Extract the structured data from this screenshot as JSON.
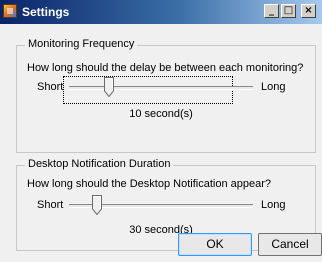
{
  "window": {
    "title": "Settings",
    "minimize_glyph": "_",
    "maximize_glyph": "□",
    "close_glyph": "×"
  },
  "monitoring": {
    "group_title": "Monitoring Frequency",
    "question": "How long should the delay be between each monitoring?",
    "min_label": "Short",
    "max_label": "Long",
    "value_text": "10 second(s)",
    "slider_level": 0.22
  },
  "notification": {
    "group_title": "Desktop Notification Duration",
    "question": "How long should the Desktop Notification appear?",
    "min_label": "Short",
    "max_label": "Long",
    "value_text": "30 second(s)",
    "slider_level": 0.15
  },
  "buttons": {
    "ok_label": "OK",
    "cancel_label": "Cancel"
  }
}
